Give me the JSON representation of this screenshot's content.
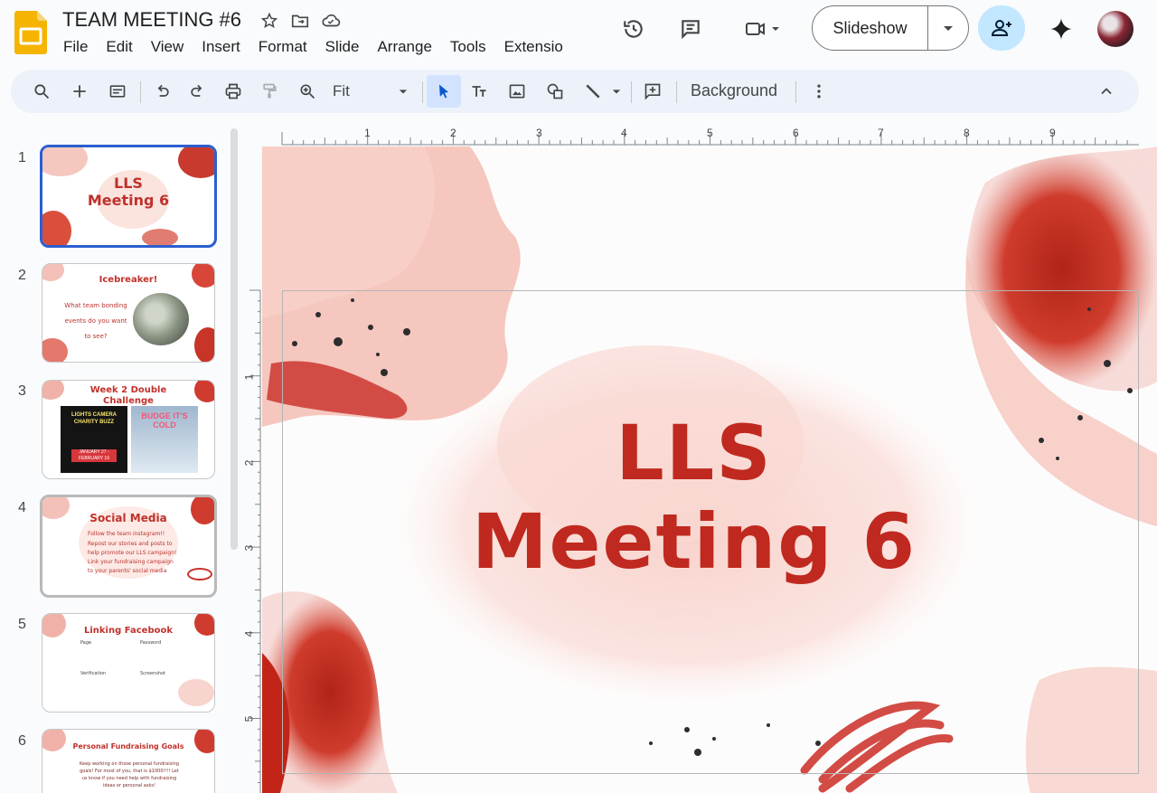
{
  "document": {
    "title": "TEAM MEETING #6"
  },
  "menu": [
    "File",
    "Edit",
    "View",
    "Insert",
    "Format",
    "Slide",
    "Arrange",
    "Tools",
    "Extensio"
  ],
  "header": {
    "slideshow_label": "Slideshow"
  },
  "toolbar": {
    "zoom": "Fit",
    "background_label": "Background"
  },
  "slides": [
    {
      "number": "1",
      "title": "LLS\nMeeting 6"
    },
    {
      "number": "2",
      "title": "Icebreaker!",
      "body": "What team bonding events do you want to see?"
    },
    {
      "number": "3",
      "title": "Week 2 Double Challenge",
      "img_left": "LIGHTS CAMERA CHARITY BUZZ",
      "img_left_date": "JANUARY 27 - FEBRUARY 16",
      "img_right": "BUDGE IT'S COLD"
    },
    {
      "number": "4",
      "title": "Social Media",
      "bullets": [
        "Follow the team instagram!!",
        "Repost our stories and posts to help promote our LLS campaign!",
        "Link your fundraising campaign to your parents' social media"
      ]
    },
    {
      "number": "5",
      "title": "Linking Facebook",
      "cols": [
        "Page",
        "Password",
        "Verification",
        "Screenshot"
      ]
    },
    {
      "number": "6",
      "title": "Personal Fundraising Goals",
      "body": "Keep working on those personal fundraising goals! For most of you, that is $1000!!!! Let us know if you need help with fundraising ideas or personal asks!"
    }
  ],
  "ruler": {
    "h": [
      "1",
      "2",
      "3",
      "4",
      "5",
      "6",
      "7",
      "8",
      "9"
    ],
    "v": [
      "1",
      "2",
      "3",
      "4",
      "5"
    ]
  },
  "canvas": {
    "title_line1": "LLS",
    "title_line2": "Meeting 6"
  },
  "colors": {
    "accent": "#c0291f",
    "selection": "#2b5fd0",
    "share": "#c2e7ff",
    "toolbar": "#edf2fa"
  }
}
